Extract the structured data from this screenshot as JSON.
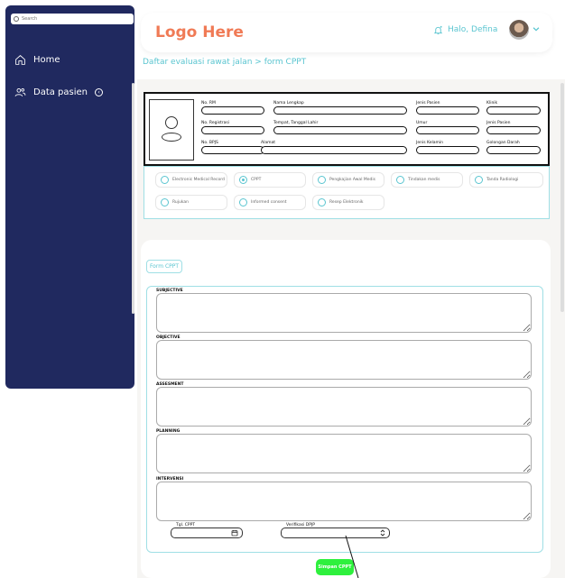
{
  "sidebar": {
    "search": {
      "placeholder": "Search"
    },
    "items": [
      {
        "label": "Home",
        "icon": "home-icon"
      },
      {
        "label": "Data pasien",
        "icon": "users-icon"
      }
    ]
  },
  "header": {
    "logo": "Logo Here",
    "greeting": "Halo, Defina"
  },
  "breadcrumb": "Daftar evaluasi rawat jalan > form CPPT",
  "patient": {
    "fields": [
      {
        "key": "no_rm",
        "label": "No. RM"
      },
      {
        "key": "nama",
        "label": "Nama Lengkap"
      },
      {
        "key": "jenis_pasien",
        "label": "Jenis Pasien"
      },
      {
        "key": "klinik",
        "label": "Klinik"
      },
      {
        "key": "no_registrasi",
        "label": "No. Registrasi"
      },
      {
        "key": "ttl",
        "label": "Tempat, Tanggal Lahir"
      },
      {
        "key": "umur",
        "label": "Umur"
      },
      {
        "key": "jenis_pasien2",
        "label": "Jenis Pasien"
      },
      {
        "key": "no_bpjs",
        "label": "No. BPJS"
      },
      {
        "key": "alamat",
        "label": "Alamat"
      },
      {
        "key": "jenis_kelamin",
        "label": "Jenis Kelamin"
      },
      {
        "key": "gol_darah",
        "label": "Golongan Darah"
      }
    ]
  },
  "tabs": [
    {
      "label": "Electronic Medical Record",
      "selected": false
    },
    {
      "label": "CPPT",
      "selected": true
    },
    {
      "label": "Pengkajian Awal Medis",
      "selected": false
    },
    {
      "label": "Tindakan medis",
      "selected": false
    },
    {
      "label": "Tanda Radiologi",
      "selected": false
    },
    {
      "label": "Rujukan",
      "selected": false
    },
    {
      "label": "Informed consent",
      "selected": false
    },
    {
      "label": "Resep Elektronik",
      "selected": false
    }
  ],
  "form": {
    "tab_label": "Form CPPT",
    "sections": [
      "SUBJECTIVE",
      "OBJECTIVE",
      "ASSESMENT",
      "PLANNING",
      "INTERVENSI"
    ],
    "date_label": "Tgl. CPPT",
    "verify_label": "Verifikasi DPJP",
    "save_label": "Simpan CPPT"
  },
  "colors": {
    "sidebar": "#20295f",
    "accent": "#5ac5d0",
    "logo": "#f07a55",
    "save": "#2ef03d"
  }
}
